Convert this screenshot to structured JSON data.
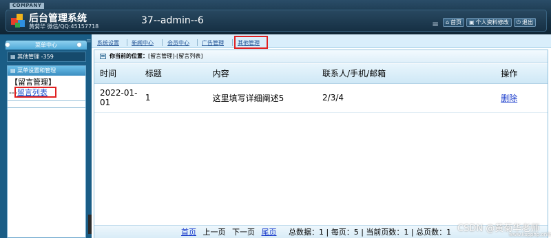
{
  "header": {
    "company_badge": "COMPANY",
    "title": "后台管理系统",
    "subtitle": "黄菊华 微信/QQ:45157718",
    "admin_text": "37--admin--6",
    "buttons": [
      {
        "label": "首页",
        "icon": "home-icon"
      },
      {
        "label": "个人资料修改",
        "icon": "user-icon"
      },
      {
        "label": "退出",
        "icon": "power-icon"
      }
    ]
  },
  "sidebar": {
    "menu_center": "菜单中心",
    "other_mgmt": "其他管理 -359",
    "panel_title": "菜单设置和管理",
    "group": "【留言管理】",
    "item_prefix": "---",
    "item_link": "留言列表"
  },
  "nav": {
    "tabs": [
      "系统设置",
      "新闻中心",
      "会员中心",
      "广告管理",
      "其他管理"
    ]
  },
  "location": {
    "label": "你当前的位置：",
    "path": "[留言管理]-[留言列表]"
  },
  "table": {
    "headers": [
      "时间",
      "标题",
      "内容",
      "联系人/手机/邮箱",
      "操作"
    ],
    "rows": [
      {
        "time_line1": "2022-01-",
        "time_line2": "01",
        "title": "1",
        "content": "这里填写详细阐述5",
        "contact": "2/3/4",
        "action": "删除"
      }
    ]
  },
  "pager": {
    "first": "首页",
    "prev": "上一页",
    "next": "下一页",
    "last": "尾页",
    "stats": "总数据：1 | 每页：5 | 当前页数：1 | 总页数：1"
  },
  "watermark": {
    "line1": "CSDN @黄菊华老师",
    "line2": "www.kspphp.online"
  },
  "colors": {
    "header_dark": "#173246",
    "sidebar_blue": "#1a5d86",
    "link_blue": "#1a3ccc",
    "highlight_red": "#e02020"
  }
}
